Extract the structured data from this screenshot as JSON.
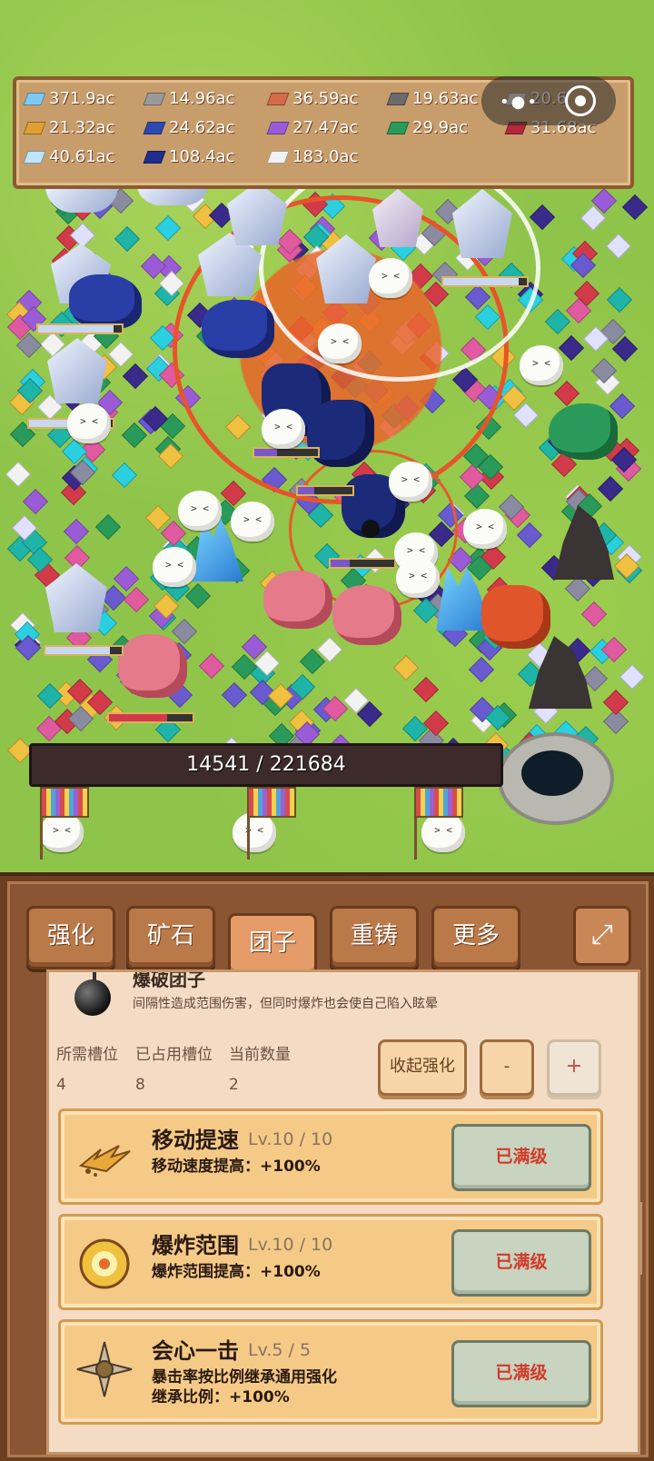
{
  "resources": [
    {
      "value": "371.9ac",
      "icon": "blue-diamond-icon",
      "color": "#7fc8f0"
    },
    {
      "value": "14.96ac",
      "icon": "silver-ingot-icon",
      "color": "#9a9a9a"
    },
    {
      "value": "36.59ac",
      "icon": "copper-ingot-icon",
      "color": "#d46a48"
    },
    {
      "value": "19.63ac",
      "icon": "iron-ingot-icon",
      "color": "#6b6b6b"
    },
    {
      "value": "20.6",
      "icon": "white-ingot-icon",
      "color": "#e0e0e0"
    },
    {
      "value": "21.32ac",
      "icon": "gold-ingot-icon",
      "color": "#e0a030"
    },
    {
      "value": "24.62ac",
      "icon": "sapphire-ingot-icon",
      "color": "#2b4ab0"
    },
    {
      "value": "27.47ac",
      "icon": "amethyst-ingot-icon",
      "color": "#9a5cd6"
    },
    {
      "value": "29.9ac",
      "icon": "emerald-ingot-icon",
      "color": "#2a9a5a"
    },
    {
      "value": "31.68ac",
      "icon": "ruby-ingot-icon",
      "color": "#b02a3a"
    },
    {
      "value": "40.61ac",
      "icon": "diamond-ingot-icon",
      "color": "#bfe6ff"
    },
    {
      "value": "108.4ac",
      "icon": "cobalt-ingot-icon",
      "color": "#1e2e8a"
    },
    {
      "value": "183.0ac",
      "icon": "platinum-ingot-icon",
      "color": "#f2f2f2"
    }
  ],
  "progress": {
    "current": "14541",
    "separator": " / ",
    "total": "221684",
    "fraction": 0.0656
  },
  "tabs": [
    {
      "label": "强化",
      "active": false
    },
    {
      "label": "矿石",
      "active": false
    },
    {
      "label": "团子",
      "active": true
    },
    {
      "label": "重铸",
      "active": false
    },
    {
      "label": "更多",
      "active": false
    }
  ],
  "expand_icon": "expand-icon",
  "unit": {
    "name": "爆破团子",
    "description": "间隔性造成范围伤害，但同时爆炸也会使自己陷入眩晕",
    "stats_headers": [
      "所需槽位",
      "已占用槽位",
      "当前数量"
    ],
    "stats_values": [
      "4",
      "8",
      "2"
    ],
    "collapse_label": "收起强化",
    "minus_label": "-",
    "plus_label": "+"
  },
  "upgrades": [
    {
      "name": "移动提速",
      "level": "Lv.10 / 10",
      "desc": "移动速度提高：+100%",
      "desc2": "",
      "button": "已满级",
      "icon": "speed-icon"
    },
    {
      "name": "爆炸范围",
      "level": "Lv.10 / 10",
      "desc": "爆炸范围提高：+100%",
      "desc2": "",
      "button": "已满级",
      "icon": "explosion-icon"
    },
    {
      "name": "会心一击",
      "level": "Lv.5 / 5",
      "desc": "暴击率按比例继承通用强化",
      "desc2": "继承比例：+100%",
      "button": "已满级",
      "icon": "critical-icon"
    }
  ],
  "palette": {
    "accent": "#e49b68",
    "panel": "#8a5533",
    "maxed_text": "#d23a2a"
  }
}
